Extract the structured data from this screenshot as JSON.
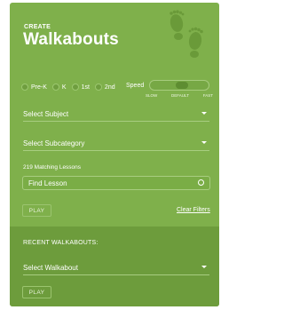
{
  "header": {
    "eyebrow": "CREATE",
    "title": "Walkabouts"
  },
  "grades": [
    {
      "label": "Pre-K"
    },
    {
      "label": "K"
    },
    {
      "label": "1st"
    },
    {
      "label": "2nd"
    }
  ],
  "speed": {
    "label": "Speed",
    "ticks": [
      "SLOW",
      "DEFAULT",
      "FAST"
    ],
    "value": "DEFAULT"
  },
  "filters": {
    "subject_placeholder": "Select Subject",
    "subcategory_placeholder": "Select Subcategory",
    "matching_count_text": "219 Matching Lessons",
    "find_placeholder": "Find Lesson",
    "play_label": "PLAY",
    "clear_label": "Clear Filters"
  },
  "recent": {
    "heading": "RECENT WALKABOUTS:",
    "select_placeholder": "Select Walkabout",
    "play_label": "PLAY"
  },
  "colors": {
    "panel": "#7fb04b",
    "panel_bottom": "#6d9c3c",
    "text": "#ffffff"
  },
  "icons": [
    "footprints-icon",
    "caret-down-icon",
    "search-icon"
  ]
}
